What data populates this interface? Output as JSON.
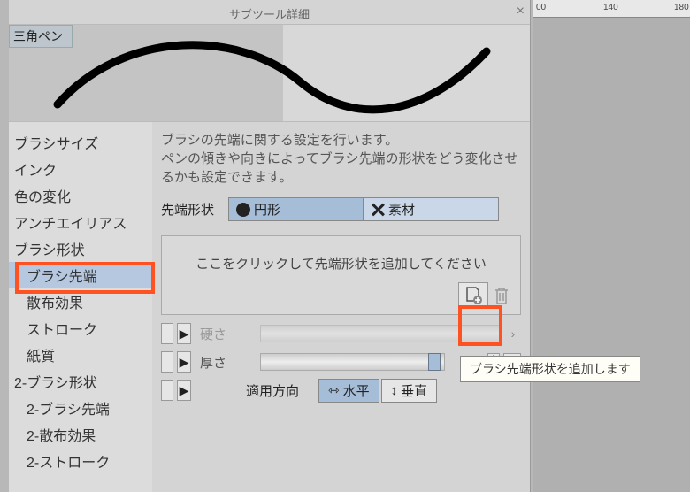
{
  "chart_data": null,
  "dialog": {
    "title": "サブツール詳細",
    "toolname": "三角ペン"
  },
  "sidebar": {
    "items": [
      {
        "label": "ブラシサイズ",
        "indent": false
      },
      {
        "label": "インク",
        "indent": false
      },
      {
        "label": "色の変化",
        "indent": false
      },
      {
        "label": "アンチエイリアス",
        "indent": false
      },
      {
        "label": "ブラシ形状",
        "indent": false
      },
      {
        "label": "ブラシ先端",
        "indent": true,
        "selected": true
      },
      {
        "label": "散布効果",
        "indent": true
      },
      {
        "label": "ストローク",
        "indent": true
      },
      {
        "label": "紙質",
        "indent": true
      },
      {
        "label": "2-ブラシ形状",
        "indent": false
      },
      {
        "label": "2-ブラシ先端",
        "indent": true
      },
      {
        "label": "2-散布効果",
        "indent": true
      },
      {
        "label": "2-ストローク",
        "indent": true
      }
    ]
  },
  "main": {
    "description": "ブラシの先端に関する設定を行います。\nペンの傾きや向きによってブラシ先端の形状をどう変化させるかも設定できます。",
    "tipshape": {
      "label": "先端形状",
      "circle": "円形",
      "material": "素材"
    },
    "addtip": {
      "text": "ここをクリックして先端形状を追加してください"
    },
    "hardness": {
      "label": "硬さ"
    },
    "thickness": {
      "label": "厚さ",
      "value": "100"
    },
    "direction": {
      "label": "適用方向",
      "horizontal": "水平",
      "vertical": "垂直"
    }
  },
  "tooltip": "ブラシ先端形状を追加します",
  "ruler": {
    "t0": "00",
    "t1": "140",
    "t2": "180"
  }
}
